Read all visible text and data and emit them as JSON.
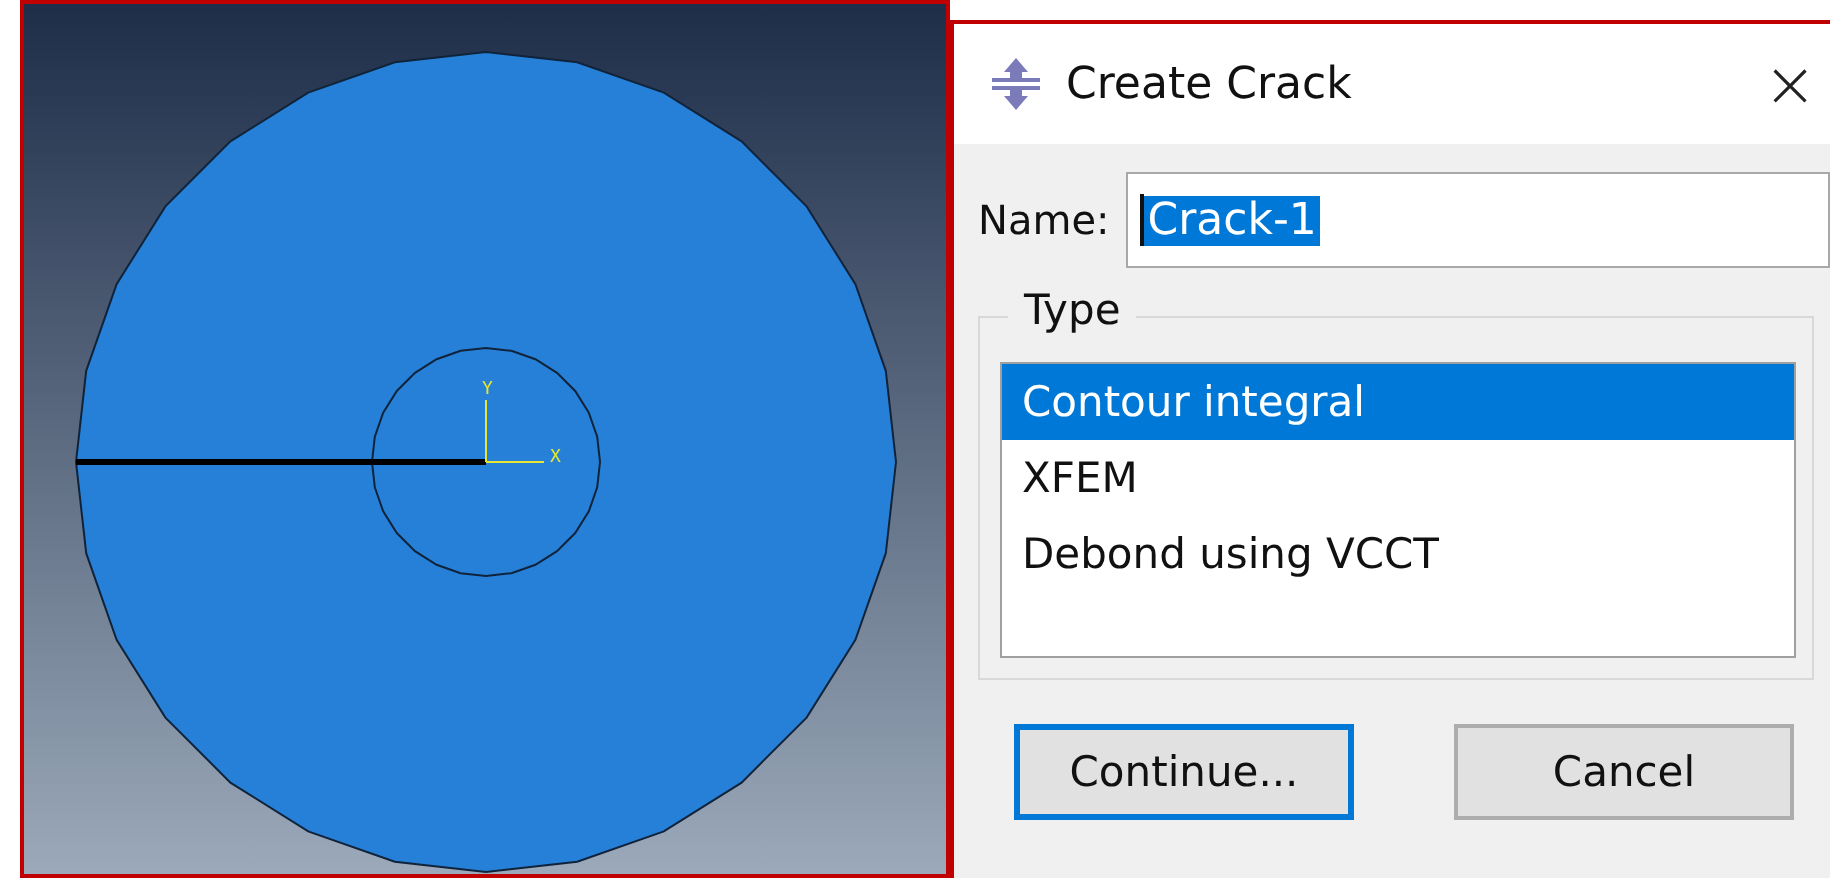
{
  "viewport": {
    "axis_labels": {
      "y": "Y",
      "x": "X"
    }
  },
  "dialog": {
    "title": "Create Crack",
    "close": "×",
    "name_field": {
      "label": "Name:",
      "value": "Crack-1",
      "text_selected": true
    },
    "type_group": {
      "legend": "Type",
      "items": [
        {
          "label": "Contour integral",
          "selected": true
        },
        {
          "label": "XFEM",
          "selected": false
        },
        {
          "label": "Debond using VCCT",
          "selected": false
        }
      ]
    },
    "buttons": [
      {
        "label": "Continue...",
        "default": true
      },
      {
        "label": "Cancel",
        "default": false
      }
    ]
  }
}
